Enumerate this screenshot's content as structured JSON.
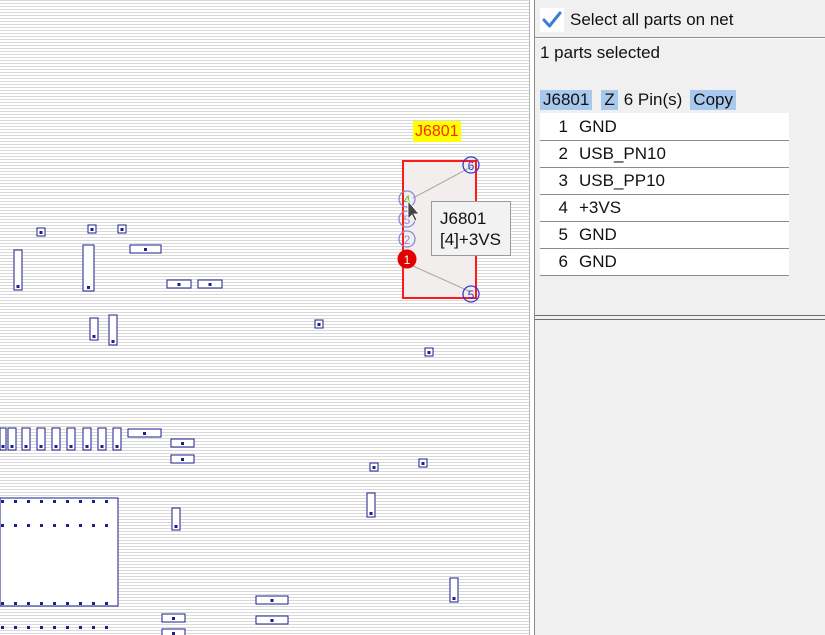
{
  "board": {
    "part_label": "J6801",
    "tooltip": {
      "line1": "J6801",
      "line2": "[4]+3VS"
    },
    "pin_marks": [
      "6",
      "4",
      "5",
      "2",
      "1",
      "5"
    ],
    "colors": {
      "highlight_outline": "#ff0000",
      "label_bg": "#ffff00",
      "label_text": "#ff2a00",
      "part_outline": "#1e1e8c",
      "selected_pin": "#e00000",
      "hover_pin": "#40c040"
    }
  },
  "panel": {
    "select_all_label": "Select all parts on net",
    "select_all_checked": true,
    "selection_count": "1 parts selected",
    "part": {
      "name": "J6801",
      "side": "Z",
      "pin_count": "6 Pin(s)",
      "copy_label": "Copy"
    },
    "pins": [
      {
        "num": "1",
        "net": "GND"
      },
      {
        "num": "2",
        "net": "USB_PN10"
      },
      {
        "num": "3",
        "net": "USB_PP10"
      },
      {
        "num": "4",
        "net": "+3VS"
      },
      {
        "num": "5",
        "net": "GND"
      },
      {
        "num": "6",
        "net": "GND"
      }
    ]
  }
}
